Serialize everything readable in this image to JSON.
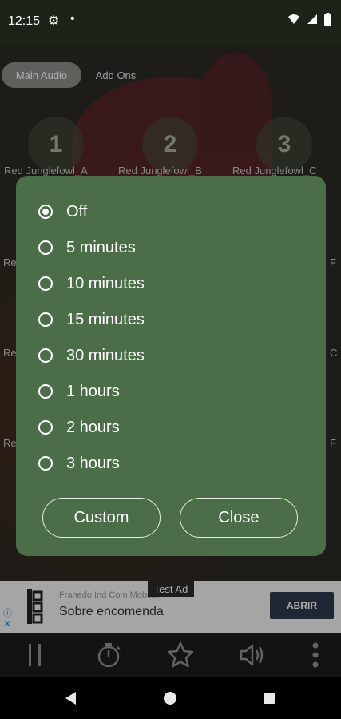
{
  "status_bar": {
    "time": "12:15"
  },
  "tabs": [
    {
      "label": "Main Audio"
    },
    {
      "label": "Add Ons"
    }
  ],
  "sounds": [
    {
      "number": "1",
      "label": "Red Junglefowl_A"
    },
    {
      "number": "2",
      "label": "Red Junglefowl_B"
    },
    {
      "number": "3",
      "label": "Red Junglefowl_C"
    }
  ],
  "edge_labels": {
    "left": [
      "Re",
      "Re",
      "Re"
    ],
    "right": [
      "F",
      "C",
      "F"
    ]
  },
  "timer_dialog": {
    "options": [
      {
        "label": "Off",
        "selected": true
      },
      {
        "label": "5 minutes",
        "selected": false
      },
      {
        "label": "10 minutes",
        "selected": false
      },
      {
        "label": "15 minutes",
        "selected": false
      },
      {
        "label": "30 minutes",
        "selected": false
      },
      {
        "label": "1 hours",
        "selected": false
      },
      {
        "label": "2 hours",
        "selected": false
      },
      {
        "label": "3 hours",
        "selected": false
      }
    ],
    "custom_label": "Custom",
    "close_label": "Close"
  },
  "ad": {
    "test_label": "Test Ad",
    "advertiser": "Franedo Ind Com Mobiliar",
    "headline": "Sobre encomenda",
    "cta": "ABRIR"
  },
  "colors": {
    "dialog_bg": "#4b6e48",
    "accent_text": "#ffffff"
  }
}
